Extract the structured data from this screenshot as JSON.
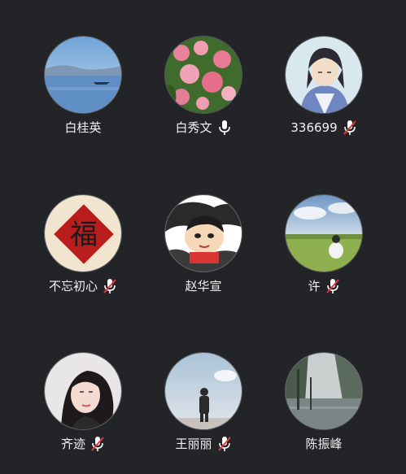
{
  "participants": [
    {
      "name": "白桂英",
      "mic": "none",
      "avatar_icon": "lake-landscape-avatar"
    },
    {
      "name": "白秀文",
      "mic": "on",
      "avatar_icon": "pink-flowers-avatar"
    },
    {
      "name": "336699",
      "mic": "muted",
      "avatar_icon": "anime-character-avatar"
    },
    {
      "name": "不忘初心",
      "mic": "muted",
      "avatar_icon": "fu-character-avatar"
    },
    {
      "name": "赵华宣",
      "mic": "none",
      "avatar_icon": "cartoon-boy-avatar"
    },
    {
      "name": "许",
      "mic": "muted",
      "avatar_icon": "grassland-person-avatar"
    },
    {
      "name": "齐迹",
      "mic": "muted",
      "avatar_icon": "woman-portrait-avatar"
    },
    {
      "name": "王丽丽",
      "mic": "muted",
      "avatar_icon": "man-sky-avatar"
    },
    {
      "name": "陈振峰",
      "mic": "none",
      "avatar_icon": "rainy-street-avatar"
    }
  ],
  "colors": {
    "background": "#232428",
    "text": "#f2f2f2",
    "mic_on": "#ffffff",
    "mic_muted": "#ffffff",
    "mic_slash": "#e23b3b"
  }
}
